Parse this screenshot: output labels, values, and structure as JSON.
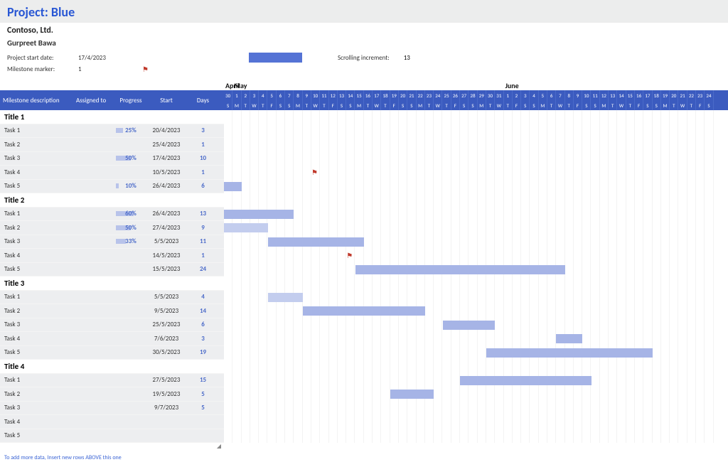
{
  "header": {
    "title": "Project: Blue"
  },
  "meta": {
    "company": "Contoso, Ltd.",
    "lead": "Gurpreet Bawa",
    "start_label": "Project start date:",
    "start_value": "17/4/2023",
    "milestone_label": "Milestone marker:",
    "milestone_value": "1",
    "scroll_label": "Scrolling increment:",
    "scroll_value": "13"
  },
  "columns": {
    "desc": "Milestone description",
    "assigned": "Assigned to",
    "progress": "Progress",
    "start": "Start",
    "days": "Days"
  },
  "timeline": {
    "months": [
      {
        "name": "April",
        "days": 1
      },
      {
        "name": "May",
        "days": 31
      },
      {
        "name": "June",
        "days": 24
      }
    ],
    "daynums": [
      "30",
      "1",
      "2",
      "3",
      "4",
      "5",
      "6",
      "7",
      "8",
      "9",
      "10",
      "11",
      "12",
      "13",
      "14",
      "15",
      "16",
      "17",
      "18",
      "19",
      "20",
      "21",
      "22",
      "23",
      "24",
      "25",
      "26",
      "27",
      "28",
      "29",
      "30",
      "31",
      "1",
      "2",
      "3",
      "4",
      "5",
      "6",
      "7",
      "8",
      "9",
      "10",
      "11",
      "12",
      "13",
      "14",
      "15",
      "16",
      "17",
      "18",
      "19",
      "20",
      "21",
      "22",
      "23",
      "24"
    ],
    "daywk": [
      "S",
      "M",
      "T",
      "W",
      "T",
      "F",
      "S",
      "S",
      "M",
      "T",
      "W",
      "T",
      "F",
      "S",
      "S",
      "M",
      "T",
      "W",
      "T",
      "F",
      "S",
      "S",
      "M",
      "T",
      "W",
      "T",
      "F",
      "S",
      "S",
      "M",
      "T",
      "W",
      "T",
      "F",
      "S",
      "S",
      "M",
      "T",
      "W",
      "T",
      "F",
      "S",
      "S",
      "M",
      "T",
      "W",
      "T",
      "F",
      "S",
      "S",
      "M",
      "T",
      "W",
      "T",
      "F",
      "S"
    ]
  },
  "rows": [
    {
      "type": "section",
      "desc": "Title 1"
    },
    {
      "type": "task",
      "desc": "Task 1",
      "progress": "25%",
      "progress_w": 10,
      "start": "20/4/2023",
      "days": "3"
    },
    {
      "type": "task",
      "desc": "Task 2",
      "start": "25/4/2023",
      "days": "1"
    },
    {
      "type": "task",
      "desc": "Task 3",
      "progress": "50%",
      "progress_w": 21,
      "start": "17/4/2023",
      "days": "10"
    },
    {
      "type": "task",
      "desc": "Task 4",
      "start": "10/5/2023",
      "days": "1",
      "milestone_col": 10
    },
    {
      "type": "task",
      "desc": "Task 5",
      "progress": "10%",
      "progress_w": 4,
      "start": "26/4/2023",
      "days": "6",
      "bar_start": 0,
      "bar_len": 2
    },
    {
      "type": "section",
      "desc": "Title 2"
    },
    {
      "type": "task",
      "desc": "Task 1",
      "progress": "60%",
      "progress_w": 25,
      "start": "26/4/2023",
      "days": "13",
      "bar_start": 0,
      "bar_len": 8
    },
    {
      "type": "task",
      "desc": "Task 2",
      "progress": "50%",
      "progress_w": 21,
      "start": "27/4/2023",
      "days": "9",
      "bar_start": 0,
      "bar_len": 5,
      "bar_lite": true
    },
    {
      "type": "task",
      "desc": "Task 3",
      "progress": "33%",
      "progress_w": 14,
      "start": "5/5/2023",
      "days": "11",
      "bar_start": 5,
      "bar_len": 11
    },
    {
      "type": "task",
      "desc": "Task 4",
      "start": "14/5/2023",
      "days": "1",
      "milestone_col": 14
    },
    {
      "type": "task",
      "desc": "Task 5",
      "start": "15/5/2023",
      "days": "24",
      "bar_start": 15,
      "bar_len": 24
    },
    {
      "type": "section",
      "desc": "Title 3"
    },
    {
      "type": "task",
      "desc": "Task 1",
      "start": "5/5/2023",
      "days": "4",
      "bar_start": 5,
      "bar_len": 4,
      "bar_lite": true
    },
    {
      "type": "task",
      "desc": "Task 2",
      "start": "9/5/2023",
      "days": "14",
      "bar_start": 9,
      "bar_len": 14
    },
    {
      "type": "task",
      "desc": "Task 3",
      "start": "25/5/2023",
      "days": "6",
      "bar_start": 25,
      "bar_len": 6
    },
    {
      "type": "task",
      "desc": "Task 4",
      "start": "7/6/2023",
      "days": "3",
      "bar_start": 38,
      "bar_len": 3
    },
    {
      "type": "task",
      "desc": "Task 5",
      "start": "30/5/2023",
      "days": "19",
      "bar_start": 30,
      "bar_len": 19
    },
    {
      "type": "section",
      "desc": "Title 4"
    },
    {
      "type": "task",
      "desc": "Task 1",
      "start": "27/5/2023",
      "days": "15",
      "bar_start": 27,
      "bar_len": 15
    },
    {
      "type": "task",
      "desc": "Task 2",
      "start": "19/5/2023",
      "days": "5",
      "bar_start": 19,
      "bar_len": 5
    },
    {
      "type": "task",
      "desc": "Task 3",
      "start": "9/7/2023",
      "days": "5"
    },
    {
      "type": "task",
      "desc": "Task 4"
    },
    {
      "type": "task",
      "desc": "Task 5"
    }
  ],
  "footer": {
    "note": "To add more data, Insert new rows ABOVE this one"
  },
  "chart_data": {
    "type": "gantt",
    "title": "Project: Blue",
    "x_start": "30/4/2023",
    "x_end": "24/6/2023",
    "tasks": [
      {
        "group": "Title 1",
        "name": "Task 1",
        "start": "20/4/2023",
        "duration_days": 3,
        "progress": 0.25
      },
      {
        "group": "Title 1",
        "name": "Task 2",
        "start": "25/4/2023",
        "duration_days": 1
      },
      {
        "group": "Title 1",
        "name": "Task 3",
        "start": "17/4/2023",
        "duration_days": 10,
        "progress": 0.5
      },
      {
        "group": "Title 1",
        "name": "Task 4",
        "start": "10/5/2023",
        "duration_days": 1,
        "milestone": true
      },
      {
        "group": "Title 1",
        "name": "Task 5",
        "start": "26/4/2023",
        "duration_days": 6,
        "progress": 0.1
      },
      {
        "group": "Title 2",
        "name": "Task 1",
        "start": "26/4/2023",
        "duration_days": 13,
        "progress": 0.6
      },
      {
        "group": "Title 2",
        "name": "Task 2",
        "start": "27/4/2023",
        "duration_days": 9,
        "progress": 0.5
      },
      {
        "group": "Title 2",
        "name": "Task 3",
        "start": "5/5/2023",
        "duration_days": 11,
        "progress": 0.33
      },
      {
        "group": "Title 2",
        "name": "Task 4",
        "start": "14/5/2023",
        "duration_days": 1,
        "milestone": true
      },
      {
        "group": "Title 2",
        "name": "Task 5",
        "start": "15/5/2023",
        "duration_days": 24
      },
      {
        "group": "Title 3",
        "name": "Task 1",
        "start": "5/5/2023",
        "duration_days": 4
      },
      {
        "group": "Title 3",
        "name": "Task 2",
        "start": "9/5/2023",
        "duration_days": 14
      },
      {
        "group": "Title 3",
        "name": "Task 3",
        "start": "25/5/2023",
        "duration_days": 6
      },
      {
        "group": "Title 3",
        "name": "Task 4",
        "start": "7/6/2023",
        "duration_days": 3
      },
      {
        "group": "Title 3",
        "name": "Task 5",
        "start": "30/5/2023",
        "duration_days": 19
      },
      {
        "group": "Title 4",
        "name": "Task 1",
        "start": "27/5/2023",
        "duration_days": 15
      },
      {
        "group": "Title 4",
        "name": "Task 2",
        "start": "19/5/2023",
        "duration_days": 5
      },
      {
        "group": "Title 4",
        "name": "Task 3",
        "start": "9/7/2023",
        "duration_days": 5
      }
    ]
  }
}
